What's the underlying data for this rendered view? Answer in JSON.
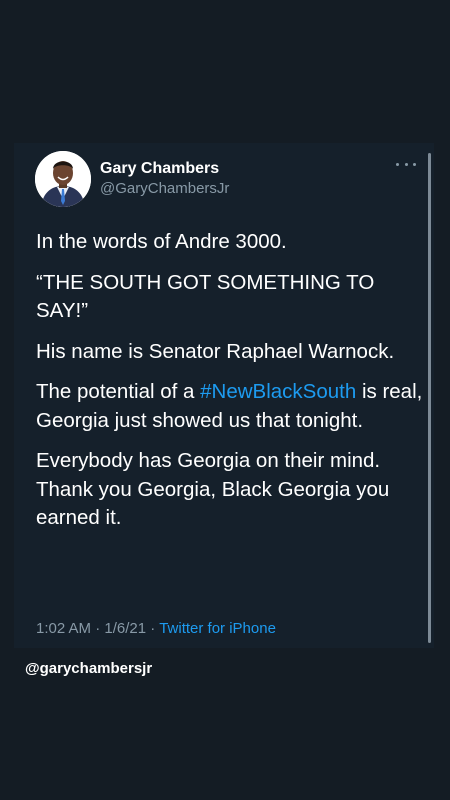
{
  "tweet": {
    "author": {
      "name": "Gary Chambers",
      "handle": "@GaryChambersJr"
    },
    "text": {
      "line1": "In the words of Andre 3000.",
      "line2": "“THE SOUTH GOT SOMETHING TO SAY!”",
      "line3": "His name is Senator Raphael Warnock.",
      "line4_before": "The potential of a ",
      "line4_hashtag": "#NewBlackSouth",
      "line4_after": " is real, Georgia just showed us that tonight.",
      "line5": "Everybody has Georgia on their mind. Thank you Georgia, Black Georgia you earned it."
    },
    "time": "1:02 AM",
    "date": "1/6/21",
    "separator": "·",
    "source": "Twitter for iPhone"
  },
  "watermark": "@garychambersjr",
  "colors": {
    "background": "#141c24",
    "card": "#15202b",
    "link": "#1d9bf0",
    "muted": "#8899a6"
  }
}
